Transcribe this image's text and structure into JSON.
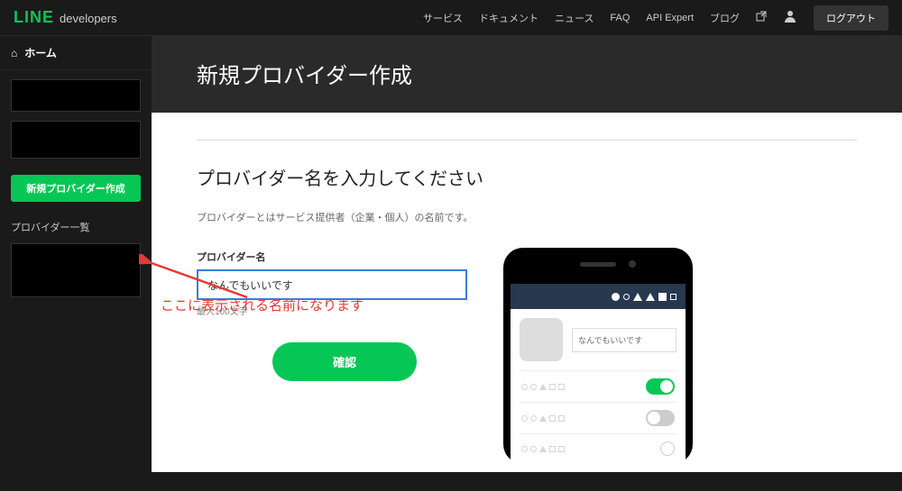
{
  "brand": {
    "line": "LINE",
    "dev": "developers"
  },
  "topnav": {
    "items": [
      "サービス",
      "ドキュメント",
      "ニュース",
      "FAQ",
      "API Expert",
      "ブログ"
    ],
    "logout": "ログアウト"
  },
  "sidebar": {
    "home": "ホーム",
    "new_provider": "新規プロバイダー作成",
    "provider_list": "プロバイダー一覧"
  },
  "page": {
    "title": "新規プロバイダー作成",
    "section_title": "プロバイダー名を入力してください",
    "hint": "プロバイダーとはサービス提供者（企業・個人）の名前です。",
    "field_label": "プロバイダー名",
    "input_value": "なんでもいいです",
    "char_limit": "最大100文字",
    "confirm": "確認"
  },
  "phone_preview": {
    "name_display": "なんでもいいです"
  },
  "annotation": "ここに表示される名前になります"
}
